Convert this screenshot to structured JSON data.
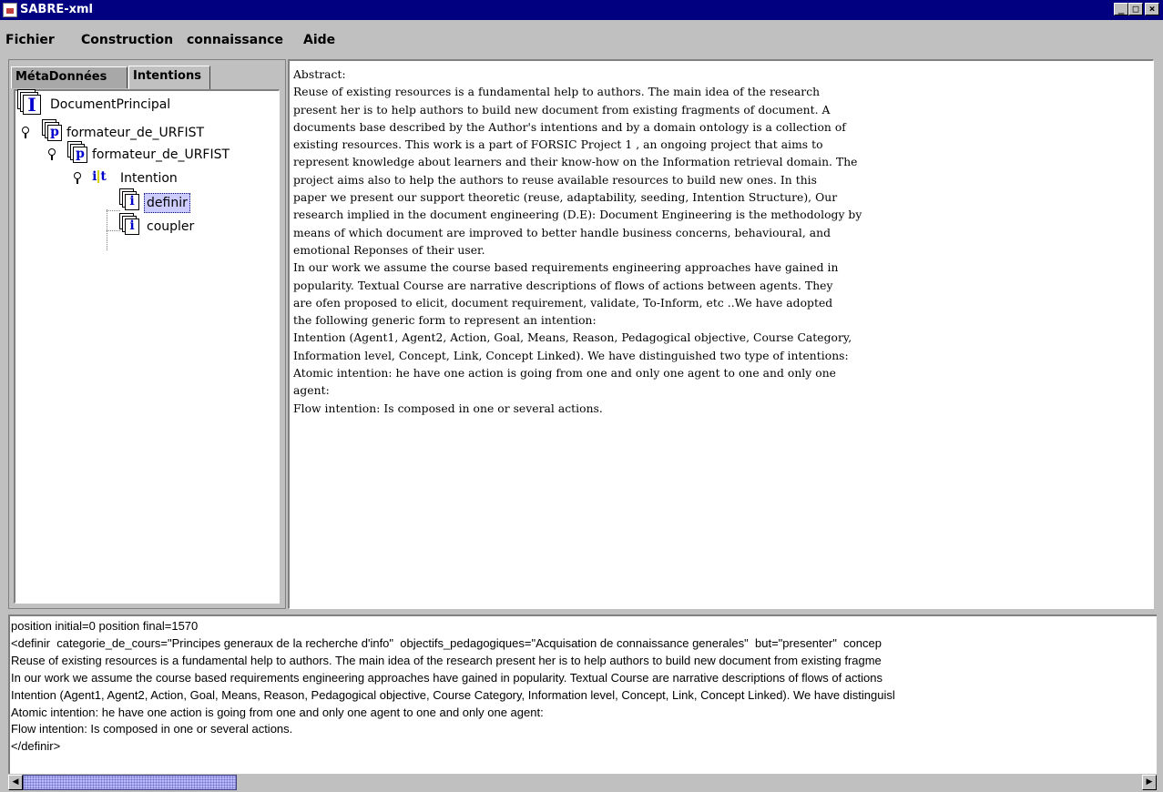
{
  "window": {
    "title": "SABRE-xml",
    "icon": "java-cup-icon",
    "buttons": {
      "minimize": "_",
      "maximize": "□",
      "close": "×"
    }
  },
  "menu": [
    "Fichier",
    "Construction",
    "connaissance",
    "Aide"
  ],
  "tabs": [
    "MétaDonnées",
    "Intentions"
  ],
  "tree": [
    {
      "label": "DocumentPrincipal",
      "icon": "I",
      "depth": 0
    },
    {
      "label": "formateur_de_URFIST",
      "icon": "p",
      "depth": 0
    },
    {
      "label": "formateur_de_URFIST",
      "icon": "p",
      "depth": 1
    },
    {
      "label": "Intention",
      "icon": "it",
      "depth": 2
    },
    {
      "label": "definir",
      "icon": "i",
      "depth": 3,
      "selected": true
    },
    {
      "label": "coupler",
      "icon": "i",
      "depth": 3
    }
  ],
  "abstract_lines": [
    "Abstract:",
    "Reuse of existing resources is a fundamental help to authors. The main idea of the research",
    "present her is to help authors to build new document from existing fragments of document. A",
    "documents base described by the Author's intentions and by a domain ontology is a collection of",
    "existing resources. This work is a part of FORSIC Project 1 , an ongoing project that aims to",
    "represent knowledge about learners and their know-how on the Information retrieval domain. The",
    "project aims also to help the authors to reuse available resources to build new ones. In this",
    "paper we present our support theoretic (reuse, adaptability, seeding, Intention Structure), Our",
    "research implied in the document engineering (D.E): Document Engineering is the methodology by",
    "means of which document are improved to better handle business concerns, behavioural, and",
    "emotional Reponses of their user.",
    "In our work we assume the course based requirements engineering approaches have gained in",
    "popularity. Textual Course are narrative descriptions of flows of actions between agents. They",
    "are ofen proposed to elicit, document requirement, validate, To-Inform, etc ..We have adopted",
    "the following generic form to represent an intention:",
    "Intention (Agent1, Agent2, Action, Goal, Means, Reason, Pedagogical objective, Course Category,",
    "Information level, Concept, Link, Concept Linked). We have distinguished two type of intentions:",
    "Atomic intention: he have one action is going from one and only one agent to one and only one",
    "agent:",
    "Flow intention: Is composed in one or several actions."
  ],
  "bottom_lines": [
    "position initial=0 position final=1570",
    "<definir  categorie_de_cours=\"Principes generaux de la recherche d'info\"  objectifs_pedagogiques=\"Acquisation de connaissance generales\"  but=\"presenter\"  concep",
    "Reuse of existing resources is a fundamental help to authors. The main idea of the research present her is to help authors to build new document from existing fragme",
    "In our work we assume the course based requirements engineering approaches have gained in popularity. Textual Course are narrative descriptions of flows of actions",
    "Intention (Agent1, Agent2, Action, Goal, Means, Reason, Pedagogical objective, Course Category, Information level, Concept, Link, Concept Linked). We have distinguisl",
    "Atomic intention: he have one action is going from one and only one agent to one and only one agent:",
    "Flow intention: Is composed in one or several actions.",
    "</definir>"
  ],
  "colors": {
    "titlebar": "#000080",
    "selection": "#ccccff",
    "scroll_thumb": "#b8b8ff"
  }
}
